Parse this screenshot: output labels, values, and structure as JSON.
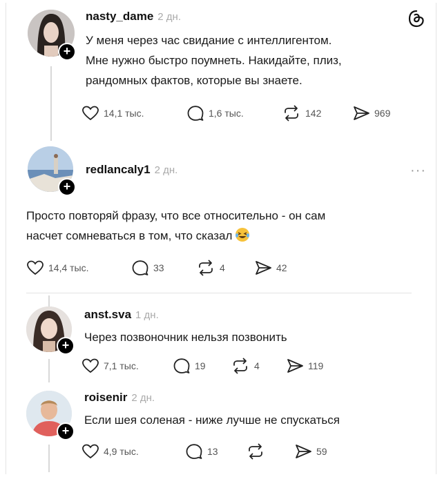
{
  "posts": [
    {
      "username": "nasty_dame",
      "time": "2 дн.",
      "lines": [
        "У меня через час свидание с интеллигентом.",
        "Мне нужно быстро поумнеть. Накидайте, плиз,",
        "рандомных фактов, которые вы знаете."
      ],
      "likes": "14,1 тыс.",
      "comments": "1,6 тыс.",
      "reposts": "142",
      "shares": "969"
    },
    {
      "username": "redlancaly1",
      "time": "2 дн.",
      "lines": [
        "Просто повторяй фразу, что все относительно - он сам",
        "насчет сомневаться в том, что сказал"
      ],
      "likes": "14,4 тыс.",
      "comments": "33",
      "reposts": "4",
      "shares": "42"
    },
    {
      "username": "anst.sva",
      "time": "1 дн.",
      "lines": [
        "Через позвоночник нельзя позвонить"
      ],
      "likes": "7,1 тыс.",
      "comments": "19",
      "reposts": "4",
      "shares": "119"
    },
    {
      "username": "roisenir",
      "time": "2 дн.",
      "lines": [
        "Если шея соленая - ниже лучше не спускаться"
      ],
      "likes": "4,9 тыс.",
      "comments": "13",
      "reposts": "",
      "shares": "59"
    }
  ],
  "icons": {
    "like": "heart-icon",
    "comment": "comment-bubble-icon",
    "repost": "repost-icon",
    "share": "send-icon",
    "app": "threads-logo-icon",
    "more": "more-dots-icon",
    "emoji": "laughing-emoji-icon",
    "follow": "plus-icon"
  }
}
